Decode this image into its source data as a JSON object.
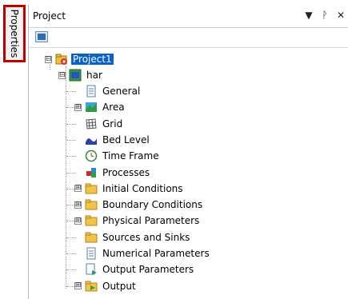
{
  "side_tab": {
    "label": "Properties"
  },
  "panel": {
    "title": "Project",
    "controls": {
      "dropdown": "▼",
      "pin": "ᚹ",
      "close": "✕"
    }
  },
  "tree": {
    "root": {
      "label": "Project1",
      "expander": "⊟"
    },
    "child": {
      "label": "har",
      "expander": "⊟"
    },
    "items": [
      {
        "label": "General",
        "icon": "document-icon",
        "expander": ""
      },
      {
        "label": "Area",
        "icon": "area-map-icon",
        "expander": "⊞"
      },
      {
        "label": "Grid",
        "icon": "grid-icon",
        "expander": ""
      },
      {
        "label": "Bed Level",
        "icon": "bed-level-icon",
        "expander": ""
      },
      {
        "label": "Time Frame",
        "icon": "clock-icon",
        "expander": ""
      },
      {
        "label": "Processes",
        "icon": "processes-icon",
        "expander": ""
      },
      {
        "label": "Initial Conditions",
        "icon": "folder-icon",
        "expander": "⊞"
      },
      {
        "label": "Boundary Conditions",
        "icon": "folder-icon",
        "expander": "⊞"
      },
      {
        "label": "Physical Parameters",
        "icon": "folder-icon",
        "expander": "⊞"
      },
      {
        "label": "Sources and Sinks",
        "icon": "folder-icon",
        "expander": ""
      },
      {
        "label": "Numerical Parameters",
        "icon": "document-icon",
        "expander": ""
      },
      {
        "label": "Output Parameters",
        "icon": "output-params-icon",
        "expander": ""
      },
      {
        "label": "Output",
        "icon": "output-folder-icon",
        "expander": "⊞"
      }
    ]
  }
}
